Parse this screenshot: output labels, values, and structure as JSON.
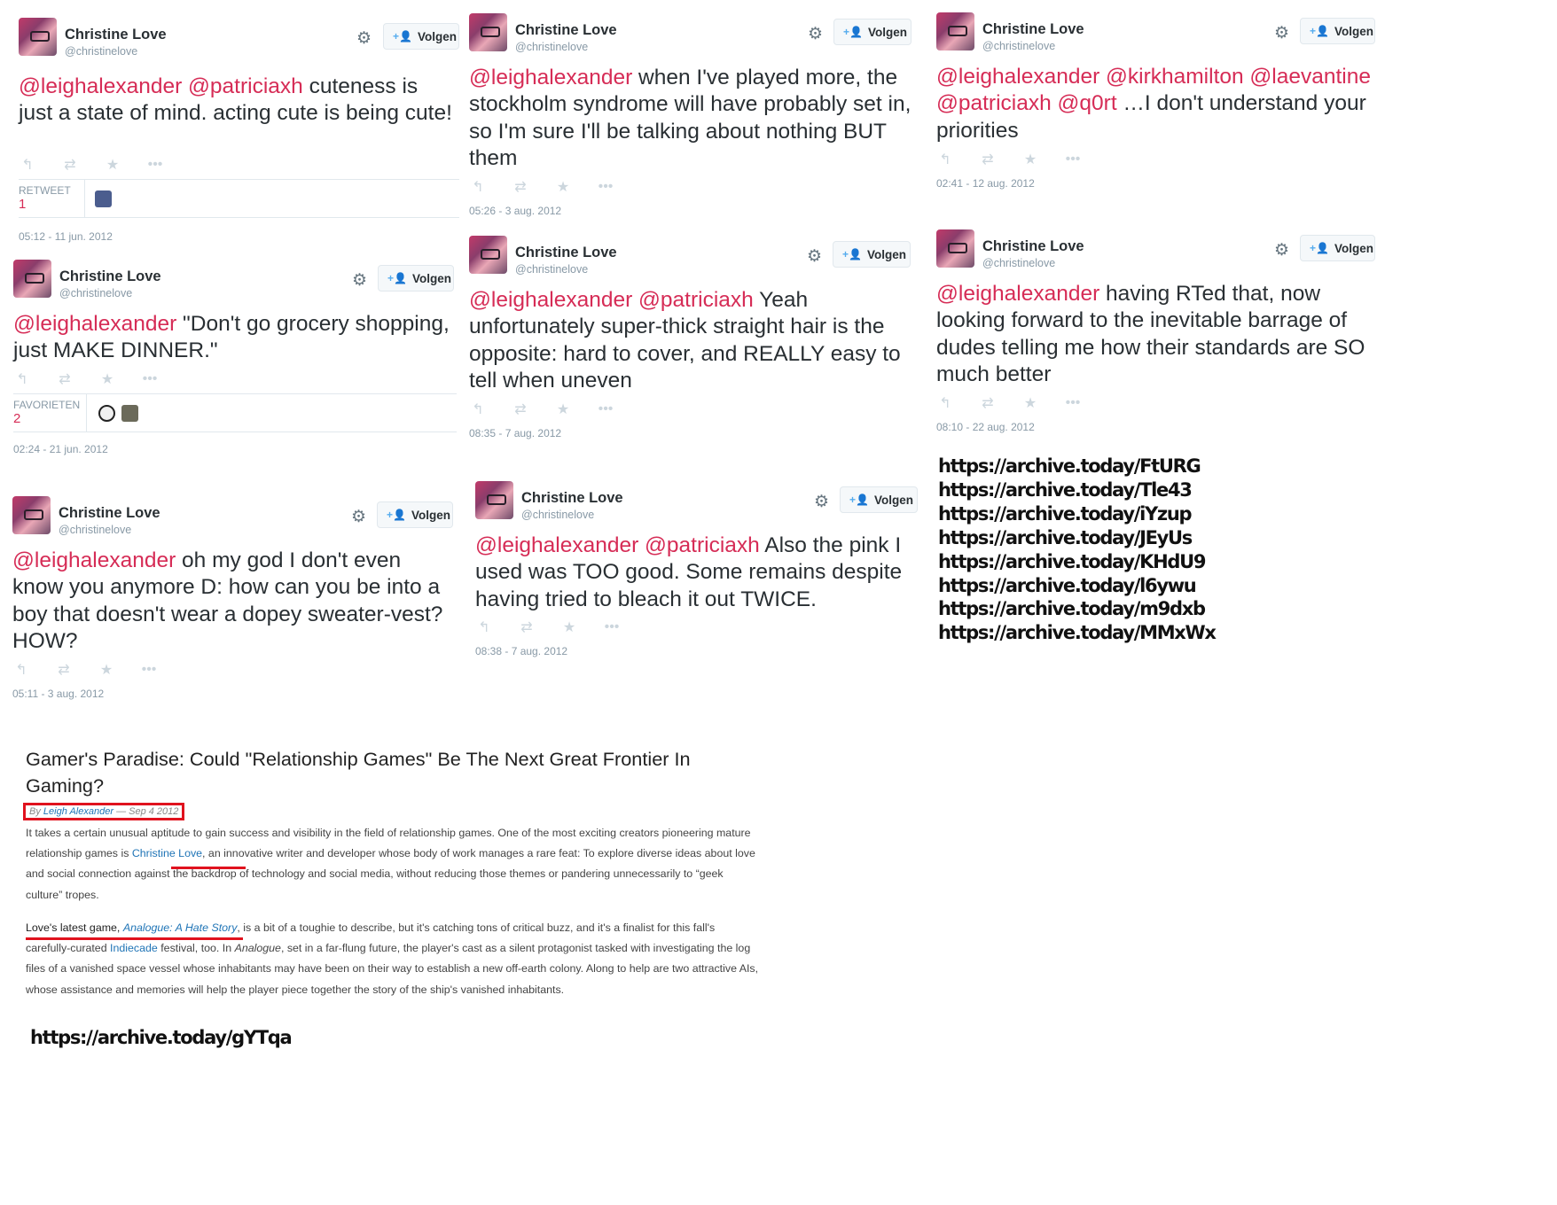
{
  "common": {
    "name": "Christine Love",
    "handle": "@christinelove",
    "follow_label": "Volgen",
    "icons": {
      "gear": "gear-icon",
      "follow": "add-user-icon",
      "reply": "reply-icon",
      "retweet": "retweet-icon",
      "favorite": "star-icon",
      "more": "more-icon"
    },
    "glyphs": {
      "gear": "⚙",
      "follow": "+👤",
      "reply": "↰",
      "retweet": "⇄",
      "favorite": "★",
      "more": "•••"
    },
    "mention_color": "#d62c56"
  },
  "tweets": [
    {
      "id": "t1",
      "mentions": "@leighalexander @patriciaxh",
      "body": " cuteness is just a state of mind. acting cute is being cute!",
      "stat_label": "RETWEET",
      "stat_count": "1",
      "time": "05:12 - 11 jun. 2012"
    },
    {
      "id": "t2",
      "mentions": "@leighalexander",
      "body": " \"Don't go grocery shopping, just MAKE DINNER.\"",
      "stat_label": "FAVORIETEN",
      "stat_count": "2",
      "time": "02:24 - 21 jun. 2012"
    },
    {
      "id": "t3",
      "mentions": "@leighalexander",
      "body": " oh my god I don't even know you anymore D: how can you be into a boy that doesn't wear a dopey sweater-vest? HOW?",
      "time": "05:11 - 3 aug. 2012"
    },
    {
      "id": "t4",
      "mentions": "@leighalexander",
      "body": " when I've played more, the stockholm syndrome will have probably set in, so I'm sure I'll be talking about nothing BUT them",
      "time": "05:26 - 3 aug. 2012"
    },
    {
      "id": "t5",
      "mentions": "@leighalexander @patriciaxh",
      "body": " Yeah unfortunately super-thick straight hair is the opposite: hard to cover, and REALLY easy to tell when uneven",
      "time": "08:35 - 7 aug. 2012"
    },
    {
      "id": "t6",
      "mentions": "@leighalexander @patriciaxh",
      "body": " Also the pink I used was TOO good. Some remains despite having tried to bleach it out TWICE.",
      "time": "08:38 - 7 aug. 2012"
    },
    {
      "id": "t7",
      "mentions": "@leighalexander @kirkhamilton @laevantine @patriciaxh @q0rt",
      "body": " …I don't understand your priorities",
      "time": "02:41 - 12 aug. 2012"
    },
    {
      "id": "t8",
      "mentions": "@leighalexander",
      "body": " having RTed that, now looking forward to the inevitable barrage of dudes telling me how their standards are SO much better",
      "time": "08:10 - 22 aug. 2012"
    }
  ],
  "archive_links": [
    "https://archive.today/FtURG",
    "https://archive.today/Tle43",
    "https://archive.today/iYzup",
    "https://archive.today/JEyUs",
    "https://archive.today/KHdU9",
    "https://archive.today/l6ywu",
    "https://archive.today/m9dxb",
    "https://archive.today/MMxWx"
  ],
  "article": {
    "title": "Gamer's Paradise: Could \"Relationship Games\" Be The Next Great Frontier In Gaming?",
    "byline_prefix": "By ",
    "byline_author": "Leigh Alexander",
    "byline_suffix": " — Sep 4 2012",
    "p1_a": "It takes a certain unusual aptitude to gain success and visibility in the field of relationship games. One of the most exciting creators pioneering mature relationship games is ",
    "p1_link": "Christine Love",
    "p1_b": ", an innovative writer and developer whose body of work manages a rare feat: To explore diverse ideas about love and social connection against the backdrop of technology and social media, without reducing those themes or pandering unnecessarily to “geek culture” tropes.",
    "p2_a": "Love's latest game, ",
    "p2_link": "Analogue: A Hate Story",
    "p2_b": ", is a bit of a toughie to describe, but it's catching tons of critical buzz, and it's a finalist for this fall's carefully-curated ",
    "p2_link2": "Indiecade",
    "p2_c": " festival, too. In ",
    "p2_em": "Analogue",
    "p2_d": ", set in a far-flung future, the player's cast as a silent protagonist tasked with investigating the log files of a vanished space vessel whose inhabitants may have been on their way to establish a new off-earth colony. Along to help are two attractive AIs, whose assistance and memories will help the player piece together the story of the ship's vanished inhabitants.",
    "archive_link": "https://archive.today/gYTqa",
    "highlight_color": "#e0121e"
  }
}
